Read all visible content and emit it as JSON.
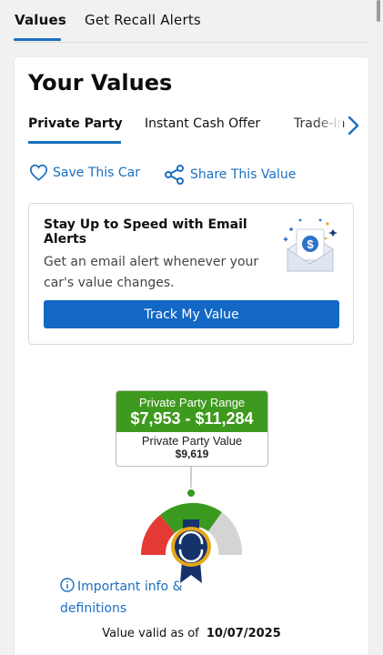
{
  "top_tabs": [
    {
      "label": "Values",
      "active": true
    },
    {
      "label": "Get Recall Alerts",
      "active": false
    }
  ],
  "card": {
    "title": "Your Values",
    "value_tabs": [
      {
        "label": "Private Party",
        "active": true
      },
      {
        "label": "Instant Cash Offer",
        "active": false
      },
      {
        "label": "Trade-In",
        "active": false
      }
    ],
    "actions": {
      "save_label": "Save This Car",
      "share_label": "Share This Value"
    },
    "alert": {
      "title": "Stay Up to Speed with Email Alerts",
      "description": "Get an email alert whenever your car's value changes.",
      "button_label": "Track My Value"
    },
    "price": {
      "range_label": "Private Party Range",
      "range_value": "$7,953 - $11,284",
      "value_label": "Private Party Value",
      "value": "$9,619"
    },
    "info_link": "Important info & definitions",
    "valid_prefix": "Value valid as of",
    "valid_date": "10/07/2025"
  },
  "colors": {
    "accent": "#1b6fc0",
    "button": "#1367c5",
    "range_green": "#3e9a1e",
    "gauge_red": "#e53935",
    "gauge_green": "#3a9a1f",
    "gauge_gray": "#d4d4d4",
    "medal_navy": "#15326b",
    "medal_gold": "#e6a817"
  },
  "icons": {
    "save": "heart-outline-icon",
    "share": "share-nodes-icon",
    "chevron": "chevron-right-icon",
    "info": "info-circle-icon",
    "alert_art": "envelope-dollar-illustration",
    "badge": "value-medal-icon"
  }
}
